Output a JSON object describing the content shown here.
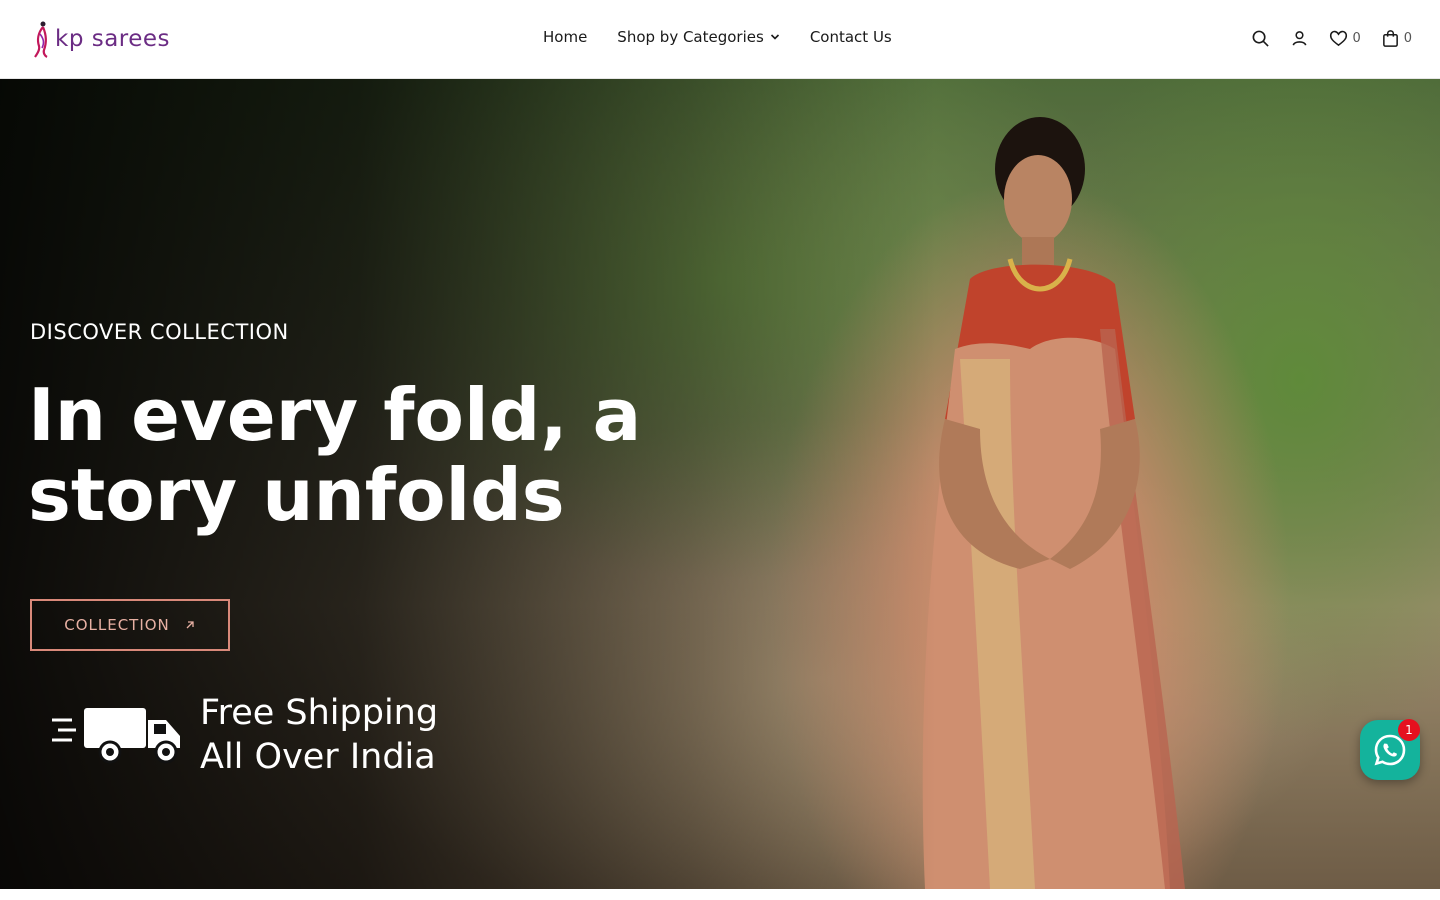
{
  "header": {
    "logo_text": "kp sarees",
    "nav": [
      {
        "label": "Home"
      },
      {
        "label": "Shop by Categories",
        "has_dropdown": true
      },
      {
        "label": "Contact Us"
      }
    ],
    "icons": {
      "search": "search-icon",
      "account": "user-icon",
      "wishlist": "heart-icon",
      "cart": "bag-icon"
    },
    "wishlist_count": "0",
    "cart_count": "0"
  },
  "hero": {
    "eyebrow": "DISCOVER COLLECTION",
    "headline": "In every fold, a story unfolds",
    "cta_label": "COLLECTION",
    "shipping_line1": "Free Shipping",
    "shipping_line2": "All Over India"
  },
  "whatsapp": {
    "badge_count": "1"
  },
  "colors": {
    "brand": "#6b2c84",
    "cta_border": "#d9897a",
    "whatsapp": "#14b39c",
    "badge": "#e5101f"
  }
}
